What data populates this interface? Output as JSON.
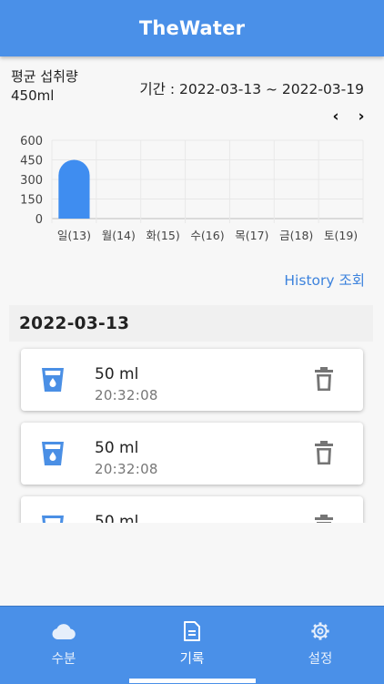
{
  "app": {
    "title": "TheWater"
  },
  "summary": {
    "avg_label": "평균 섭취량",
    "avg_value": "450ml",
    "period_text": "기간 : 2022-03-13 ~ 2022-03-19"
  },
  "nav": {
    "prev": "‹",
    "next": "›"
  },
  "chart_data": {
    "type": "bar",
    "categories": [
      "일(13)",
      "월(14)",
      "화(15)",
      "수(16)",
      "목(17)",
      "금(18)",
      "토(19)"
    ],
    "values": [
      450,
      0,
      0,
      0,
      0,
      0,
      0
    ],
    "y_ticks": [
      "600",
      "450",
      "300",
      "150",
      "0"
    ],
    "ylim": [
      0,
      600
    ],
    "grid": true,
    "bar_color": "#3f8df0"
  },
  "history_link": "History 조회",
  "date_header": "2022-03-13",
  "records": [
    {
      "amount": "50 ml",
      "time": "20:32:08"
    },
    {
      "amount": "50 ml",
      "time": "20:32:08"
    },
    {
      "amount": "50 ml",
      "time": ""
    }
  ],
  "tabs": [
    {
      "label": "수분",
      "icon": "cloud-icon",
      "active": false
    },
    {
      "label": "기록",
      "icon": "document-icon",
      "active": true
    },
    {
      "label": "설정",
      "icon": "gear-icon",
      "active": false
    }
  ],
  "colors": {
    "primary": "#4a90e8",
    "accent_text": "#3d83dd",
    "cup": "#4a8fe5",
    "trash": "#757575"
  }
}
